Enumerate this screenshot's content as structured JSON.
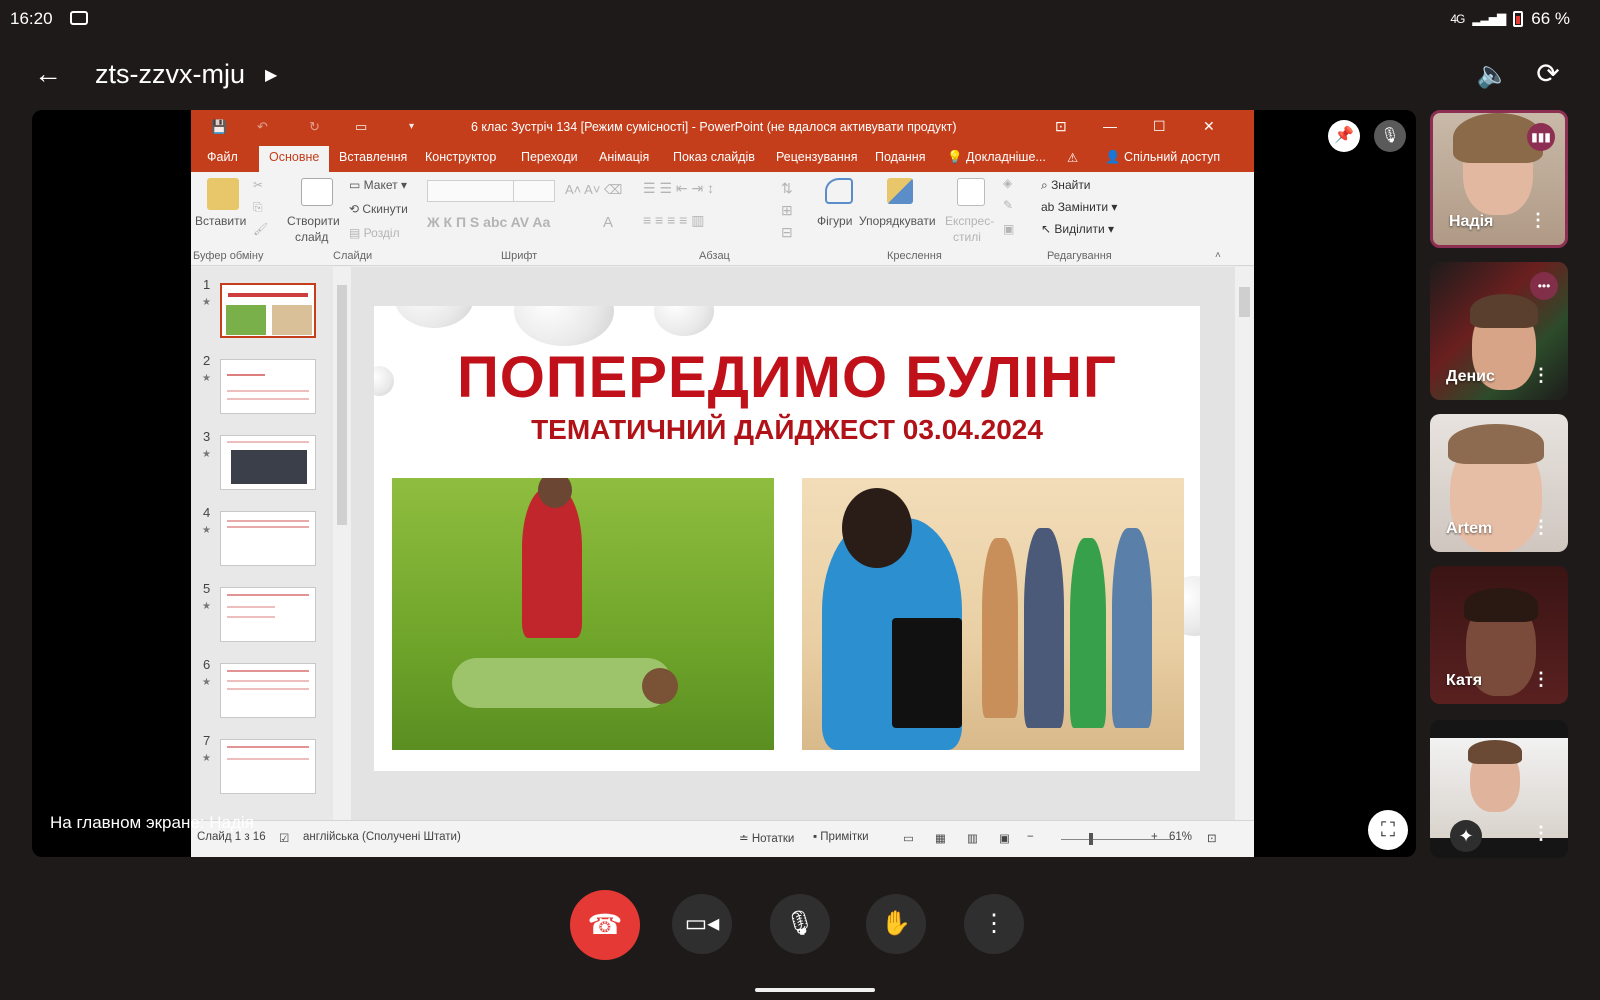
{
  "status_bar": {
    "time": "16:20",
    "signal_text": "4G",
    "battery": "66 %"
  },
  "header": {
    "meeting_code": "zts-zzvx-mju",
    "icons": [
      "back-arrow-icon",
      "speaker-icon",
      "camera-flip-icon"
    ]
  },
  "stage": {
    "caption": "На главном экране: Надія"
  },
  "powerpoint": {
    "window_title": "6 клас Зустріч 134 [Режим сумісності] - PowerPoint (не вдалося активувати продукт)",
    "tabs": [
      "Файл",
      "Основне",
      "Вставлення",
      "Конструктор",
      "Переходи",
      "Анімація",
      "Показ слайдів",
      "Рецензування",
      "Подання",
      "Докладніше..."
    ],
    "active_tab": "Основне",
    "share": "Спільний доступ",
    "ribbon": {
      "paste": "Вставити",
      "new_slide_1": "Створити",
      "new_slide_2": "слайд",
      "layout": "Макет",
      "reset": "Скинути",
      "section": "Розділ",
      "font_btns": "Ж  К  П  S  abc  AV  Aa",
      "shapes": "Фігури",
      "arrange": "Упорядкувати",
      "express_1": "Експрес-",
      "express_2": "стилі",
      "find": "Знайти",
      "replace": "Замінити",
      "select": "Виділити",
      "groups": [
        "Буфер обміну",
        "Слайди",
        "Шрифт",
        "Абзац",
        "Креслення",
        "Редагування"
      ]
    },
    "thumbnails": [
      "1",
      "2",
      "3",
      "4",
      "5",
      "6",
      "7"
    ],
    "slide": {
      "title": "ПОПЕРЕДИМО БУЛІНГ",
      "subtitle": "ТЕМАТИЧНИЙ ДАЙДЖЕСТ 03.04.2024"
    },
    "status": {
      "slide_of": "Слайд 1 з 16",
      "language": "англійська (Сполучені Штати)",
      "notes": "Нотатки",
      "comments": "Примітки",
      "zoom": "61%"
    }
  },
  "participants": [
    {
      "name": "Надія",
      "speaking": true
    },
    {
      "name": "Денис",
      "speaking": false
    },
    {
      "name": "Artem",
      "speaking": false
    },
    {
      "name": "Катя",
      "speaking": false
    },
    {
      "name": "",
      "speaking": false
    }
  ],
  "colors": {
    "background": "#1f1a1a",
    "ppt_accent": "#c43e1c",
    "slide_title": "#c0111a",
    "end_call": "#e53935",
    "speaking_border": "#8d2f52"
  }
}
